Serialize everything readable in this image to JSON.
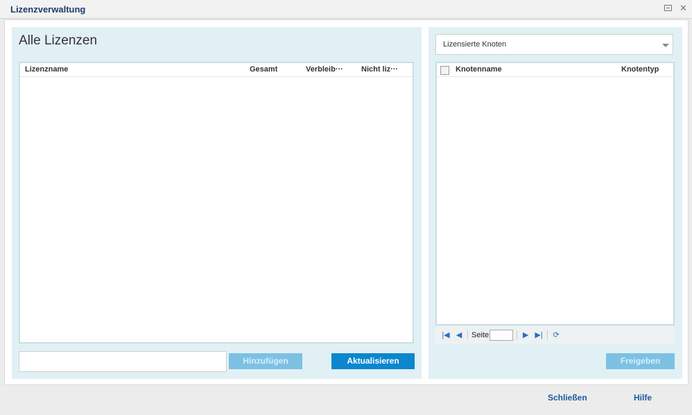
{
  "window": {
    "title": "Lizenzverwaltung",
    "controls": [
      {
        "icon": "restore-icon"
      },
      {
        "icon": "close-icon",
        "glyph": "✕"
      }
    ]
  },
  "left_panel": {
    "title": "Alle Lizenzen",
    "table": {
      "columns": [
        "Lizenzname",
        "Gesamt",
        "Verbleib···",
        "Nicht liz···"
      ],
      "rows": []
    },
    "input": {
      "value": "",
      "placeholder": ""
    },
    "add_label": "Hinzufügen",
    "update_label": "Aktualisieren"
  },
  "right_panel": {
    "filter": {
      "selected": "Lizensierte Knoten"
    },
    "table": {
      "columns": [
        "Knotenname",
        "Knotentyp"
      ],
      "rows": []
    },
    "pager": {
      "page_label": "Seite",
      "page_value": "",
      "icons": [
        "first-page-icon",
        "prev-page-icon",
        "next-page-icon",
        "last-page-icon",
        "refresh-icon"
      ]
    },
    "release_label": "Freigeben"
  },
  "footer": {
    "close_label": "Schließen",
    "help_label": "Hilfe"
  },
  "colors": {
    "accent": "#0b86cf",
    "panel_bg": "#e1f0f4",
    "title_text": "#1f3a6b",
    "disabled_button": "#7cc1e3"
  }
}
